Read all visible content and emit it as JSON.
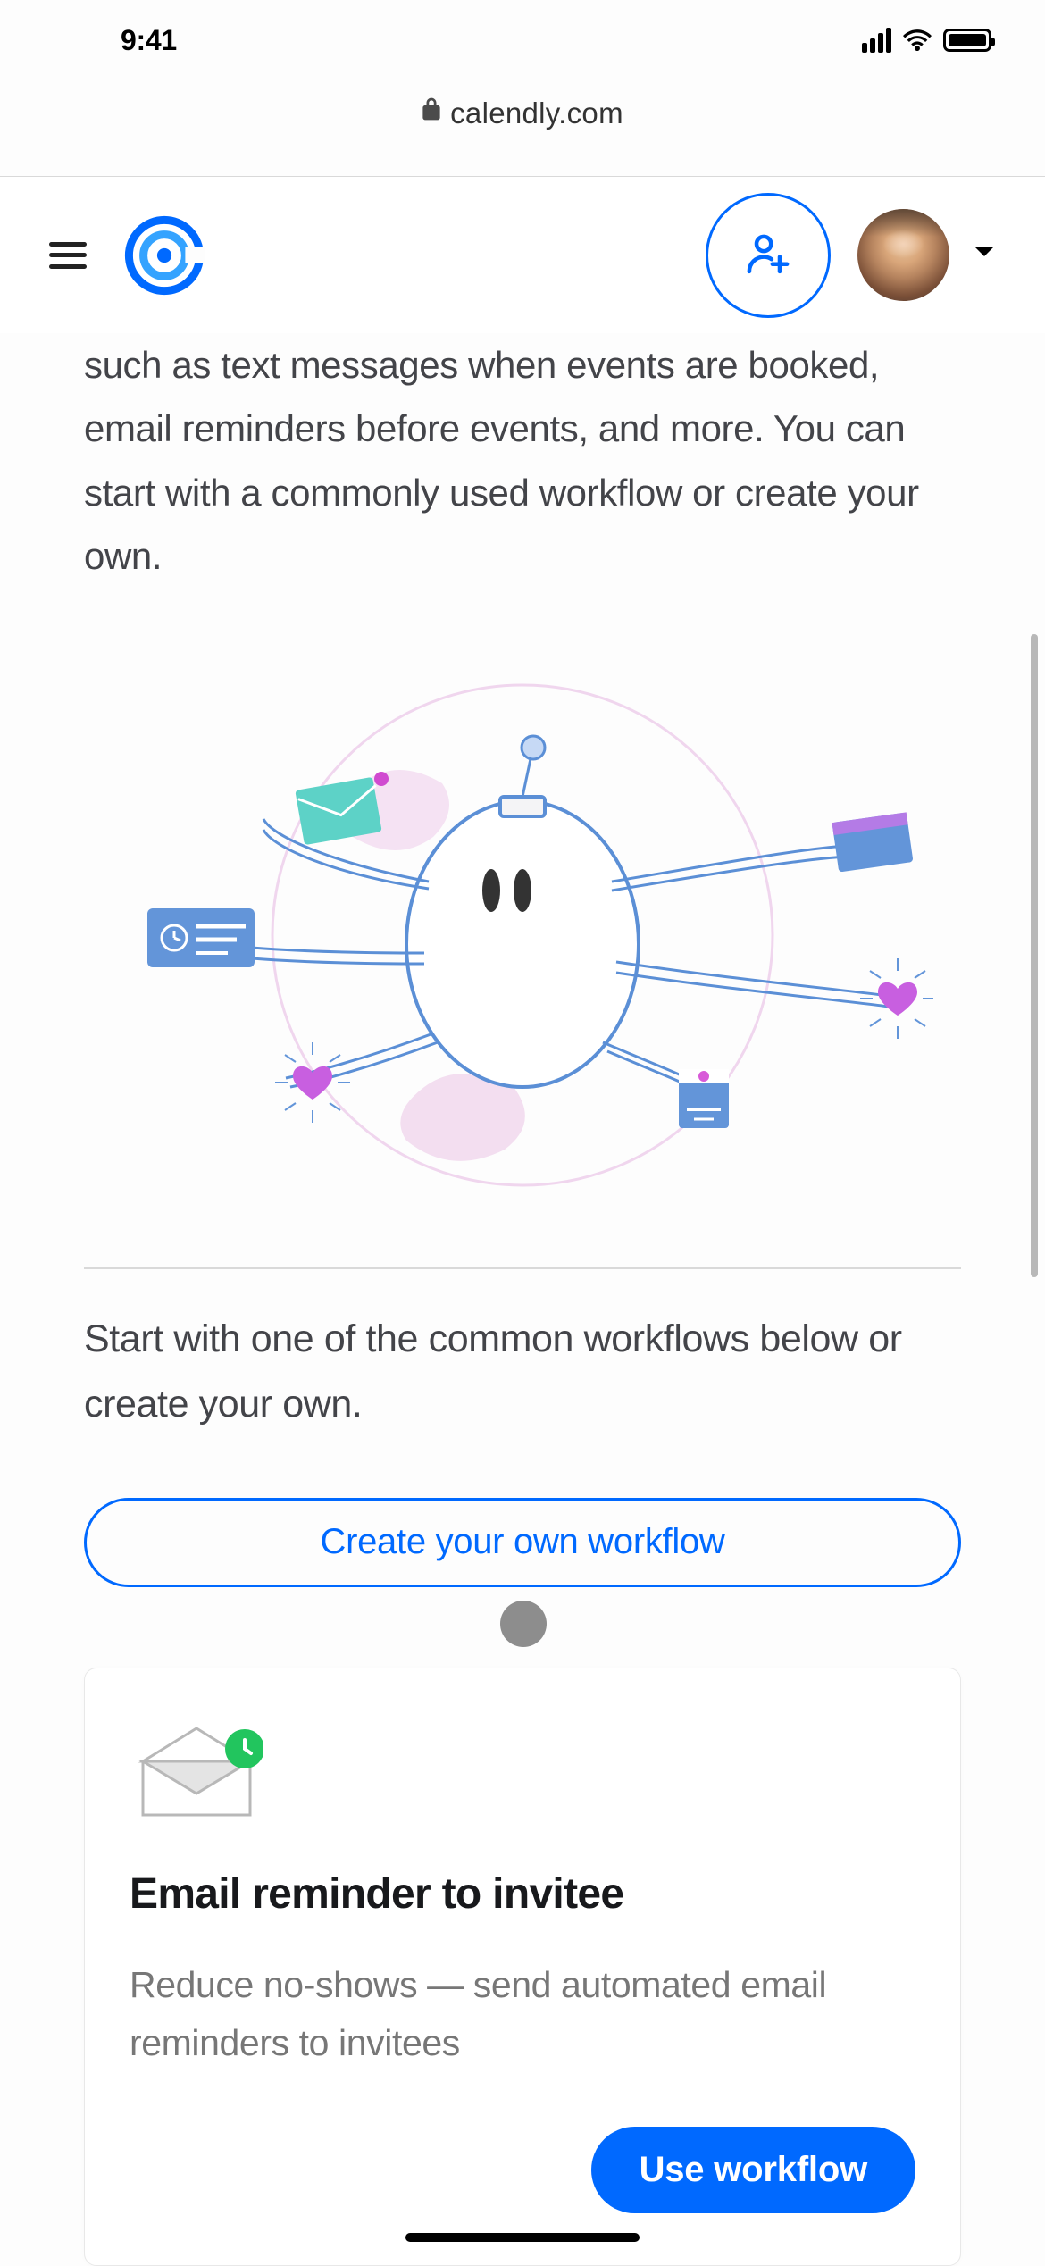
{
  "status": {
    "time": "9:41"
  },
  "browser": {
    "url": "calendly.com"
  },
  "main": {
    "description": "such as text messages when events are booked, email reminders before events, and more. You can start with a commonly used workflow or create your own.",
    "subtitle": "Start with one of the common workflows below or create your own.",
    "create_button_label": "Create your own workflow"
  },
  "workflow_card": {
    "title": "Email reminder to invitee",
    "description": "Reduce no-shows — send automated email reminders to invitees",
    "button_label": "Use workflow"
  }
}
